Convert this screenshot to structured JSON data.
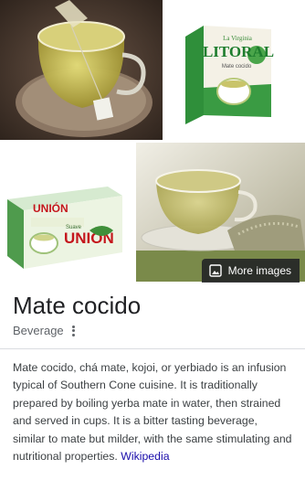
{
  "images": {
    "image_1_alt": "Mate cocido tea in glass cup",
    "image_2_alt": "La Virginia Litoral mate cocido box",
    "image_3_alt": "Unión suave mate cocido box",
    "image_4_alt": "Mate cocido cup with yerba",
    "litoral_brand": "LITORAL",
    "litoral_maker": "La Virginia",
    "litoral_sub": "Mate cocido",
    "union_brand": "UNIÓN",
    "union_sub": "Suave"
  },
  "more_images": {
    "label": "More images",
    "icon": "image-icon"
  },
  "entity": {
    "title": "Mate cocido",
    "subtitle": "Beverage"
  },
  "description": {
    "text": "Mate cocido, chá mate, kojoi, or yerbiado is an infusion typical of Southern Cone cuisine. It is traditionally prepared by boiling yerba mate in water, then strained and served in cups. It is a bitter tasting beverage, similar to mate but milder, with the same stimulating and nutritional properties. ",
    "source_link": "Wikipedia"
  },
  "colors": {
    "title": "#202124",
    "subtitle": "#5f6368",
    "link": "#1a0dab",
    "overlay": "#202124"
  }
}
